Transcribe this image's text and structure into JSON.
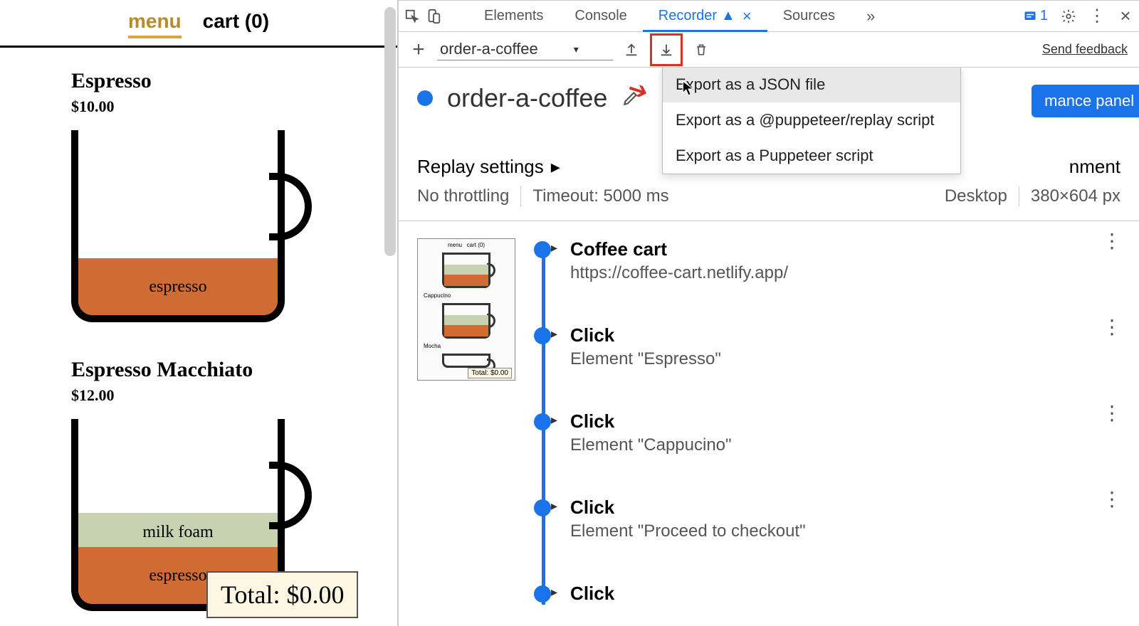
{
  "nav": {
    "menu": "menu",
    "cart": "cart (0)"
  },
  "items": [
    {
      "title": "Espresso",
      "price": "$10.00",
      "layers": [
        "espresso"
      ]
    },
    {
      "title": "Espresso Macchiato",
      "price": "$12.00",
      "layers": [
        "milk foam",
        "espresso"
      ]
    }
  ],
  "total": "Total: $0.00",
  "devtools": {
    "tabs": {
      "elements": "Elements",
      "console": "Console",
      "recorder": "Recorder",
      "sources": "Sources"
    },
    "issues_count": "1",
    "rec_toolbar": {
      "name": "order-a-coffee",
      "feedback": "Send feedback"
    },
    "rec_title": "order-a-coffee",
    "perf_button": "mance panel",
    "export_menu": {
      "json": "Export as a JSON file",
      "replay": "Export as a @puppeteer/replay script",
      "puppeteer": "Export as a Puppeteer script"
    },
    "replay": {
      "label": "Replay settings",
      "throttle": "No throttling",
      "timeout": "Timeout: 5000 ms",
      "env_label": "nment",
      "device": "Desktop",
      "size": "380×604 px"
    },
    "thumb_total": "Total: $0.00",
    "steps": [
      {
        "title": "Coffee cart",
        "sub": "https://coffee-cart.netlify.app/"
      },
      {
        "title": "Click",
        "sub": "Element \"Espresso\""
      },
      {
        "title": "Click",
        "sub": "Element \"Cappucino\""
      },
      {
        "title": "Click",
        "sub": "Element \"Proceed to checkout\""
      },
      {
        "title": "Click",
        "sub": ""
      }
    ]
  }
}
